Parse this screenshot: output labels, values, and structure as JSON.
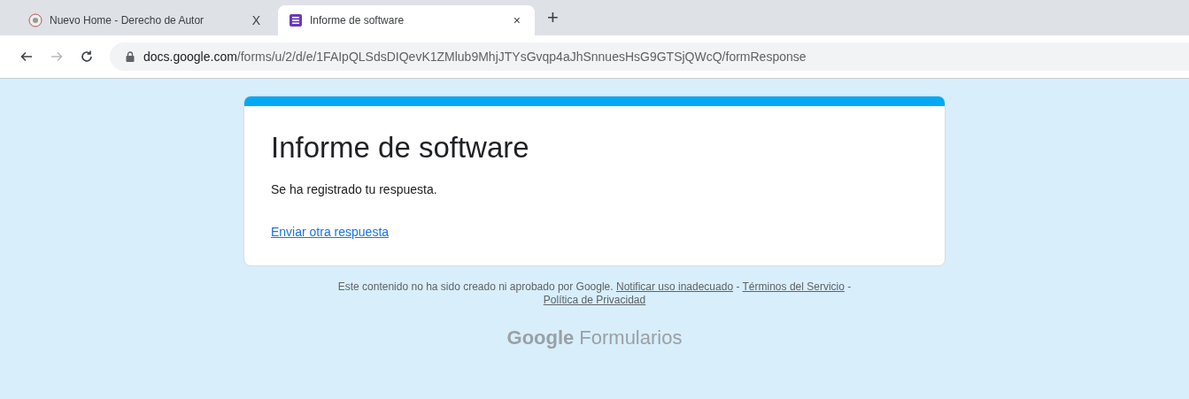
{
  "tabs": [
    {
      "title": "Nuevo Home - Derecho de Autor",
      "close": "X",
      "selected": false
    },
    {
      "title": "Informe de software",
      "close": "×",
      "selected": true
    }
  ],
  "new_tab": "+",
  "address_bar": {
    "host": "docs.google.com",
    "path": "/forms/u/2/d/e/1FAIpQLSdsDIQevK1ZMlub9MhjJTYsGvqp4aJhSnnuesHsG9GTSjQWcQ/formResponse"
  },
  "form": {
    "title": "Informe de software",
    "message": "Se ha registrado tu respuesta.",
    "link": "Enviar otra respuesta"
  },
  "footer": {
    "notice": "Este contenido no ha sido creado ni aprobado por Google.",
    "links": [
      "Notificar uso inadecuado",
      "Términos del Servicio",
      "Política de Privacidad"
    ],
    "separator": "-"
  },
  "brand": {
    "strong": "Google",
    "light": "Formularios"
  }
}
